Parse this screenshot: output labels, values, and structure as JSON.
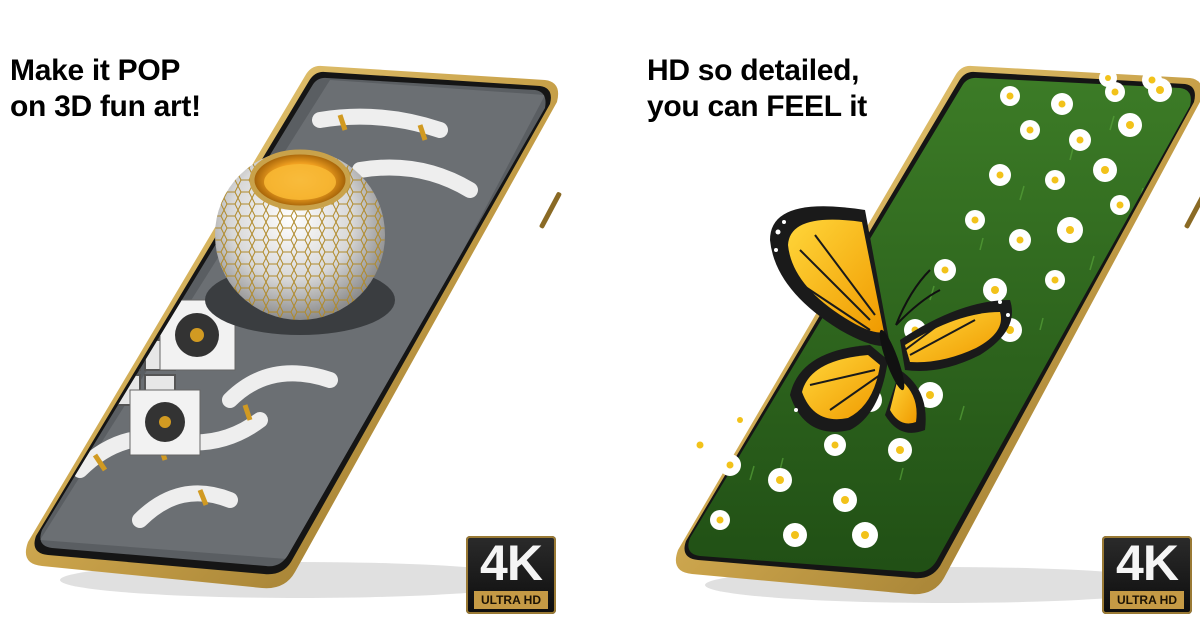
{
  "left_panel": {
    "headline_line1": "Make it POP",
    "headline_line2": "on 3D fun art!",
    "badge_main": "4K",
    "badge_sub": "ULTRA HD"
  },
  "right_panel": {
    "headline_line1": "HD so detailed,",
    "headline_line2": "you can FEEL it",
    "badge_main": "4K",
    "badge_sub": "ULTRA HD"
  },
  "colors": {
    "phone_frame_gold": "#c9a24a",
    "phone_bezel": "#151515",
    "badge_accent": "#c59a45",
    "sphere_orange": "#f0a020",
    "grass_green": "#2f6b1f",
    "butterfly_orange": "#f5b800"
  }
}
